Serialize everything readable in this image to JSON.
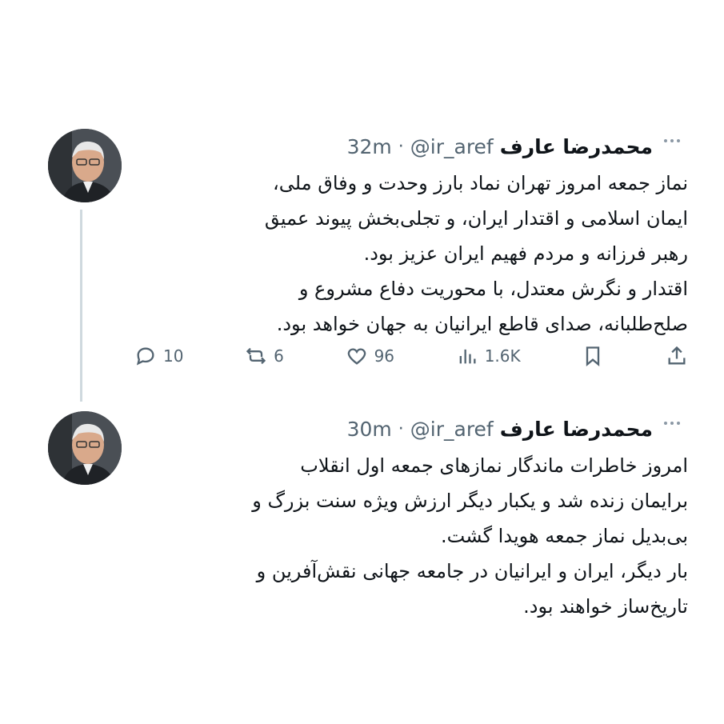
{
  "tweets": [
    {
      "author_name": "محمدرضا عارف",
      "handle": "@ir_aref",
      "separator": "·",
      "time": "32m",
      "lines": [
        "نماز جمعه امروز تهران نماد بارز وحدت و وفاق ملی،",
        "ایمان اسلامی و اقتدار ایران، و تجلی‌بخش پیوند عمیق",
        "رهبر فرزانه و مردم فهیم ایران عزیز بود.",
        "اقتدار و نگرش معتدل، با محوریت دفاع مشروع و",
        "صلح‌طلبانه، صدای قاطع ایرانیان به جهان خواهد بود."
      ],
      "stats": {
        "replies": "10",
        "retweets": "6",
        "likes": "96",
        "views": "1.6K"
      }
    },
    {
      "author_name": "محمدرضا عارف",
      "handle": "@ir_aref",
      "separator": "·",
      "time": "30m",
      "lines": [
        "امروز خاطرات ماندگار نمازهای جمعه اول انقلاب",
        "برایمان زنده شد و یکبار دیگر ارزش ویژه سنت بزرگ و",
        "بی‌بدیل نماز جمعه هویدا گشت.",
        "بار دیگر، ایران و ایرانیان در جامعه جهانی نقش‌آفرین و",
        "تاریخ‌ساز خواهند بود."
      ]
    }
  ],
  "icons": {
    "reply": "reply-icon",
    "retweet": "retweet-icon",
    "like": "heart-icon",
    "views": "analytics-icon",
    "bookmark": "bookmark-icon",
    "share": "share-icon",
    "more": "more-icon"
  }
}
